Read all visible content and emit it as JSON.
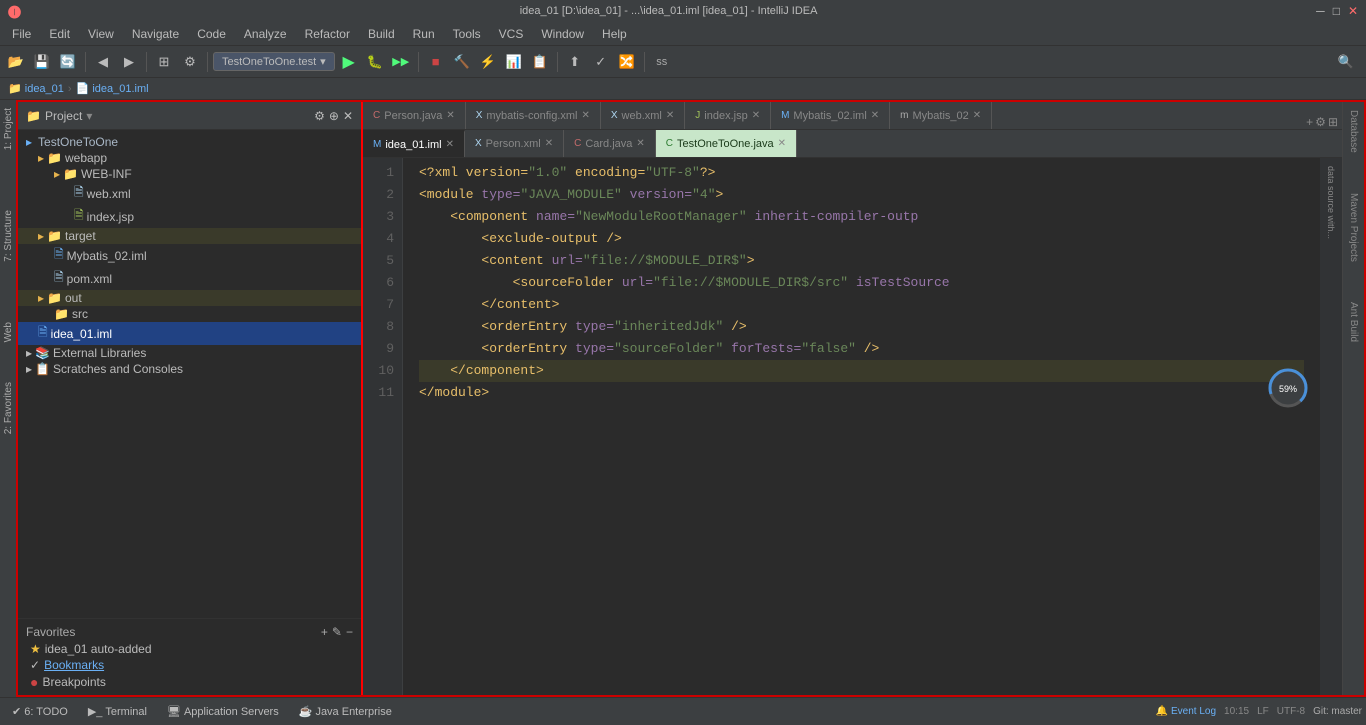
{
  "titleBar": {
    "title": "idea_01 [D:\\idea_01] - ...\\idea_01.iml [idea_01] - IntelliJ IDEA",
    "minimize": "─",
    "maximize": "□",
    "close": "✕"
  },
  "menuBar": {
    "items": [
      "File",
      "Edit",
      "View",
      "Navigate",
      "Code",
      "Analyze",
      "Refactor",
      "Build",
      "Run",
      "Tools",
      "VCS",
      "Window",
      "Help"
    ]
  },
  "toolbar": {
    "configLabel": "TestOneToOne.test",
    "ssLabel": "ss"
  },
  "breadcrumb": {
    "items": [
      "idea_01",
      "idea_01.iml"
    ]
  },
  "projectPanel": {
    "title": "Project",
    "items": [
      {
        "label": "TestOneToOne",
        "type": "module",
        "indent": 0
      },
      {
        "label": "webapp",
        "type": "folder",
        "indent": 1
      },
      {
        "label": "WEB-INF",
        "type": "folder",
        "indent": 2
      },
      {
        "label": "web.xml",
        "type": "xml",
        "indent": 3
      },
      {
        "label": "index.jsp",
        "type": "jsp",
        "indent": 3
      },
      {
        "label": "target",
        "type": "folder",
        "indent": 1
      },
      {
        "label": "Mybatis_02.iml",
        "type": "iml",
        "indent": 2
      },
      {
        "label": "pom.xml",
        "type": "xml",
        "indent": 2
      },
      {
        "label": "out",
        "type": "folder",
        "indent": 1
      },
      {
        "label": "src",
        "type": "folder",
        "indent": 2
      },
      {
        "label": "idea_01.iml",
        "type": "iml",
        "indent": 1
      },
      {
        "label": "External Libraries",
        "type": "library",
        "indent": 0
      },
      {
        "label": "Scratches and Consoles",
        "type": "folder",
        "indent": 0
      }
    ]
  },
  "favoritesPanel": {
    "title": "Favorites",
    "items": [
      {
        "label": "idea_01  auto-added",
        "type": "star"
      },
      {
        "label": "Bookmarks",
        "type": "folder"
      },
      {
        "label": "Breakpoints",
        "type": "bullet"
      }
    ]
  },
  "editorTabs": {
    "topRow": [
      {
        "label": "Person.java",
        "type": "java",
        "active": false
      },
      {
        "label": "mybatis-config.xml",
        "type": "xml",
        "active": false
      },
      {
        "label": "web.xml",
        "type": "xml",
        "active": false
      },
      {
        "label": "index.jsp",
        "type": "jsp",
        "active": false
      },
      {
        "label": "Mybatis_02.iml",
        "type": "iml",
        "active": false
      },
      {
        "label": "Mybatis_02",
        "type": "module",
        "active": false
      }
    ],
    "bottomRow": [
      {
        "label": "idea_01.iml",
        "type": "iml",
        "active": true
      },
      {
        "label": "Person.xml",
        "type": "xml",
        "active": false
      },
      {
        "label": "Card.java",
        "type": "java",
        "active": false
      },
      {
        "label": "TestOneToOne.java",
        "type": "java",
        "active": false
      }
    ]
  },
  "codeContent": {
    "lines": [
      {
        "num": 1,
        "text": "<?xml version=\"1.0\" encoding=\"UTF-8\"?>",
        "highlight": false
      },
      {
        "num": 2,
        "text": "<module type=\"JAVA_MODULE\" version=\"4\">",
        "highlight": false
      },
      {
        "num": 3,
        "text": "    <component name=\"NewModuleRootManager\" inherit-compiler-outp",
        "highlight": false
      },
      {
        "num": 4,
        "text": "        <exclude-output />",
        "highlight": false
      },
      {
        "num": 5,
        "text": "        <content url=\"file://$MODULE_DIR$\">",
        "highlight": false
      },
      {
        "num": 6,
        "text": "            <sourceFolder url=\"file://$MODULE_DIR$/src\" isTestSource",
        "highlight": false
      },
      {
        "num": 7,
        "text": "        </content>",
        "highlight": false
      },
      {
        "num": 8,
        "text": "        <orderEntry type=\"inheritedJdk\" />",
        "highlight": false
      },
      {
        "num": 9,
        "text": "        <orderEntry type=\"sourceFolder\" forTests=\"false\" />",
        "highlight": false
      },
      {
        "num": 10,
        "text": "    </component>",
        "highlight": true
      },
      {
        "num": 11,
        "text": "</module>",
        "highlight": false
      }
    ]
  },
  "rightSidebar": {
    "tabs": [
      "Database",
      "Maven Projects",
      "Ant Build"
    ]
  },
  "bottomBar": {
    "tabs": [
      "6: TODO",
      "Terminal",
      "Application Servers",
      "Java Enterprise"
    ],
    "rightInfo": {
      "encoding": "UTF-8",
      "lf": "LF",
      "line": "10:15",
      "eventLog": "Event Log"
    }
  },
  "progressCircle": {
    "value": "59%"
  }
}
